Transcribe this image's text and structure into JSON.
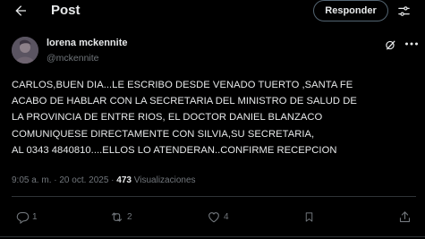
{
  "header": {
    "title": "Post",
    "reply_label": "Responder"
  },
  "post": {
    "author_name": "lorena mckennite",
    "author_handle": "@mckennite",
    "text": "CARLOS,BUEN DIA...LE ESCRIBO DESDE VENADO TUERTO ,SANTA FE\nACABO DE HABLAR CON LA SECRETARIA DEL MINISTRO DE SALUD DE\nLA PROVINCIA DE ENTRE RIOS, EL DOCTOR DANIEL BLANZACO\nCOMUNIQUESE DIRECTAMENTE CON SILVIA,SU SECRETARIA,\nAL 0343 4840810....ELLOS LO ATENDERAN..CONFIRME RECEPCION",
    "timestamp": "9:05 a. m. · 20 oct. 2025 · ",
    "views_count": "473",
    "views_label": "Visualizaciones"
  },
  "actions": {
    "replies": "1",
    "reposts": "2",
    "likes": "4"
  },
  "colors": {
    "background": "#000000",
    "text": "#e7e9ea",
    "muted": "#71767b",
    "border": "#2f3336"
  }
}
